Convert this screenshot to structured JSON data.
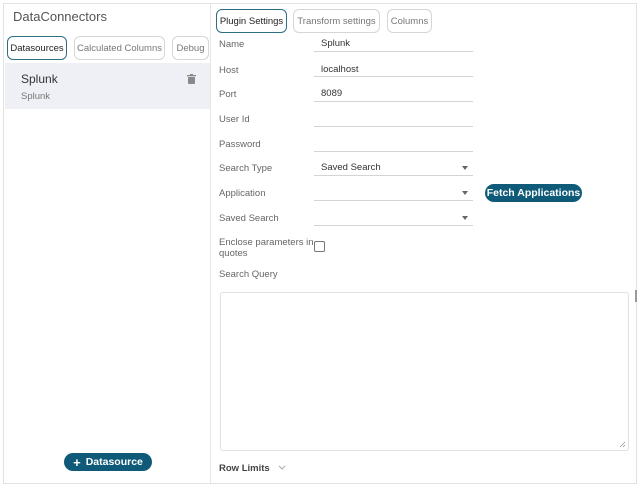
{
  "left_panel": {
    "title": "DataConnectors",
    "tabs": [
      "Datasources",
      "Calculated Columns",
      "Debug"
    ],
    "datasources": [
      {
        "name": "Splunk",
        "type": "Splunk"
      }
    ],
    "add_button": "Datasource"
  },
  "right_panel": {
    "tabs": [
      "Plugin Settings",
      "Transform settings",
      "Columns"
    ],
    "fields": {
      "name": {
        "label": "Name",
        "value": "Splunk"
      },
      "host": {
        "label": "Host",
        "value": "localhost"
      },
      "port": {
        "label": "Port",
        "value": "8089"
      },
      "user_id": {
        "label": "User Id",
        "value": ""
      },
      "password": {
        "label": "Password",
        "value": ""
      },
      "search_type": {
        "label": "Search Type",
        "value": "Saved Search"
      },
      "application": {
        "label": "Application",
        "value": ""
      },
      "saved_search": {
        "label": "Saved Search",
        "value": ""
      },
      "enclose": {
        "label_line1": "Enclose parameters in",
        "label_line2": "quotes",
        "checked": false
      },
      "search_query": {
        "label": "Search Query",
        "value": ""
      }
    },
    "fetch_button": "Fetch Applications",
    "row_limits": "Row Limits"
  },
  "colors": {
    "accent": "#0f5a78",
    "selected_bg": "#eef0f5"
  }
}
